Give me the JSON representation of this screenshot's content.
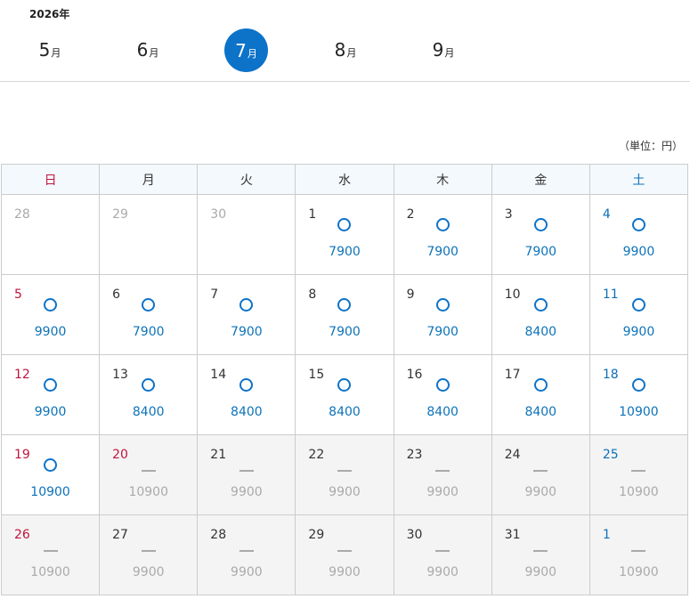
{
  "year": "2026年",
  "months": [
    {
      "num": "5",
      "suffix": "月",
      "active": false
    },
    {
      "num": "6",
      "suffix": "月",
      "active": false
    },
    {
      "num": "7",
      "suffix": "月",
      "active": true
    },
    {
      "num": "8",
      "suffix": "月",
      "active": false
    },
    {
      "num": "9",
      "suffix": "月",
      "active": false
    }
  ],
  "unit": "（単位：円）",
  "weekdays": [
    "日",
    "月",
    "火",
    "水",
    "木",
    "金",
    "土"
  ],
  "symbols": {
    "available": "○",
    "unavailable": "—"
  },
  "colors": {
    "accent": "#0d73c9",
    "sunday": "#c0143c",
    "saturday": "#0d6fb8",
    "muted": "#aaaaaa",
    "closed_bg": "#f4f4f4",
    "header_bg": "#f4f9fd"
  },
  "weeks": [
    [
      {
        "day": "28",
        "other": true,
        "status": "none",
        "price": ""
      },
      {
        "day": "29",
        "other": true,
        "status": "none",
        "price": ""
      },
      {
        "day": "30",
        "other": true,
        "status": "none",
        "price": ""
      },
      {
        "day": "1",
        "status": "available",
        "price": "7900"
      },
      {
        "day": "2",
        "status": "available",
        "price": "7900"
      },
      {
        "day": "3",
        "status": "available",
        "price": "7900"
      },
      {
        "day": "4",
        "status": "available",
        "price": "9900"
      }
    ],
    [
      {
        "day": "5",
        "status": "available",
        "price": "9900"
      },
      {
        "day": "6",
        "status": "available",
        "price": "7900"
      },
      {
        "day": "7",
        "status": "available",
        "price": "7900"
      },
      {
        "day": "8",
        "status": "available",
        "price": "7900"
      },
      {
        "day": "9",
        "status": "available",
        "price": "7900"
      },
      {
        "day": "10",
        "status": "available",
        "price": "8400"
      },
      {
        "day": "11",
        "status": "available",
        "price": "9900"
      }
    ],
    [
      {
        "day": "12",
        "status": "available",
        "price": "9900"
      },
      {
        "day": "13",
        "status": "available",
        "price": "8400"
      },
      {
        "day": "14",
        "status": "available",
        "price": "8400"
      },
      {
        "day": "15",
        "status": "available",
        "price": "8400"
      },
      {
        "day": "16",
        "status": "available",
        "price": "8400"
      },
      {
        "day": "17",
        "status": "available",
        "price": "8400"
      },
      {
        "day": "18",
        "status": "available",
        "price": "10900"
      }
    ],
    [
      {
        "day": "19",
        "status": "available",
        "price": "10900"
      },
      {
        "day": "20",
        "status": "unavailable",
        "price": "10900"
      },
      {
        "day": "21",
        "status": "unavailable",
        "price": "9900"
      },
      {
        "day": "22",
        "status": "unavailable",
        "price": "9900"
      },
      {
        "day": "23",
        "status": "unavailable",
        "price": "9900"
      },
      {
        "day": "24",
        "status": "unavailable",
        "price": "9900"
      },
      {
        "day": "25",
        "status": "unavailable",
        "price": "10900"
      }
    ],
    [
      {
        "day": "26",
        "status": "unavailable",
        "price": "10900"
      },
      {
        "day": "27",
        "status": "unavailable",
        "price": "9900"
      },
      {
        "day": "28",
        "status": "unavailable",
        "price": "9900"
      },
      {
        "day": "29",
        "status": "unavailable",
        "price": "9900"
      },
      {
        "day": "30",
        "status": "unavailable",
        "price": "9900"
      },
      {
        "day": "31",
        "status": "unavailable",
        "price": "9900"
      },
      {
        "day": "1",
        "other_month_next": true,
        "status": "unavailable",
        "price": "10900"
      }
    ]
  ]
}
